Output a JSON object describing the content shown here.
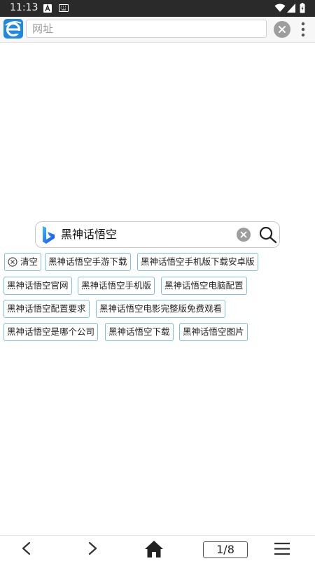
{
  "status_bar": {
    "time": "11:13"
  },
  "address_bar": {
    "placeholder": "网址"
  },
  "search": {
    "query": "黑神话悟空"
  },
  "suggestions": {
    "clear_label": "清空",
    "items": [
      "黑神话悟空手游下载",
      "黑神话悟空手机版下载安卓版",
      "黑神话悟空官网",
      "黑神话悟空手机版",
      "黑神话悟空电脑配置",
      "黑神话悟空配置要求",
      "黑神话悟空电影完整版免费观看",
      "黑神话悟空是哪个公司",
      "黑神话悟空下载",
      "黑神话悟空图片"
    ]
  },
  "bottom_bar": {
    "tab_counter": "1/8"
  },
  "colors": {
    "chip_border": "#7cc0e6",
    "browser_blue": "#1e88e5",
    "status_bg": "#2a2a2a"
  },
  "icons": [
    "browser-logo-icon",
    "clear-icon",
    "more-vert-icon",
    "bing-logo-icon",
    "search-icon",
    "back-icon",
    "forward-icon",
    "home-icon",
    "menu-icon"
  ]
}
